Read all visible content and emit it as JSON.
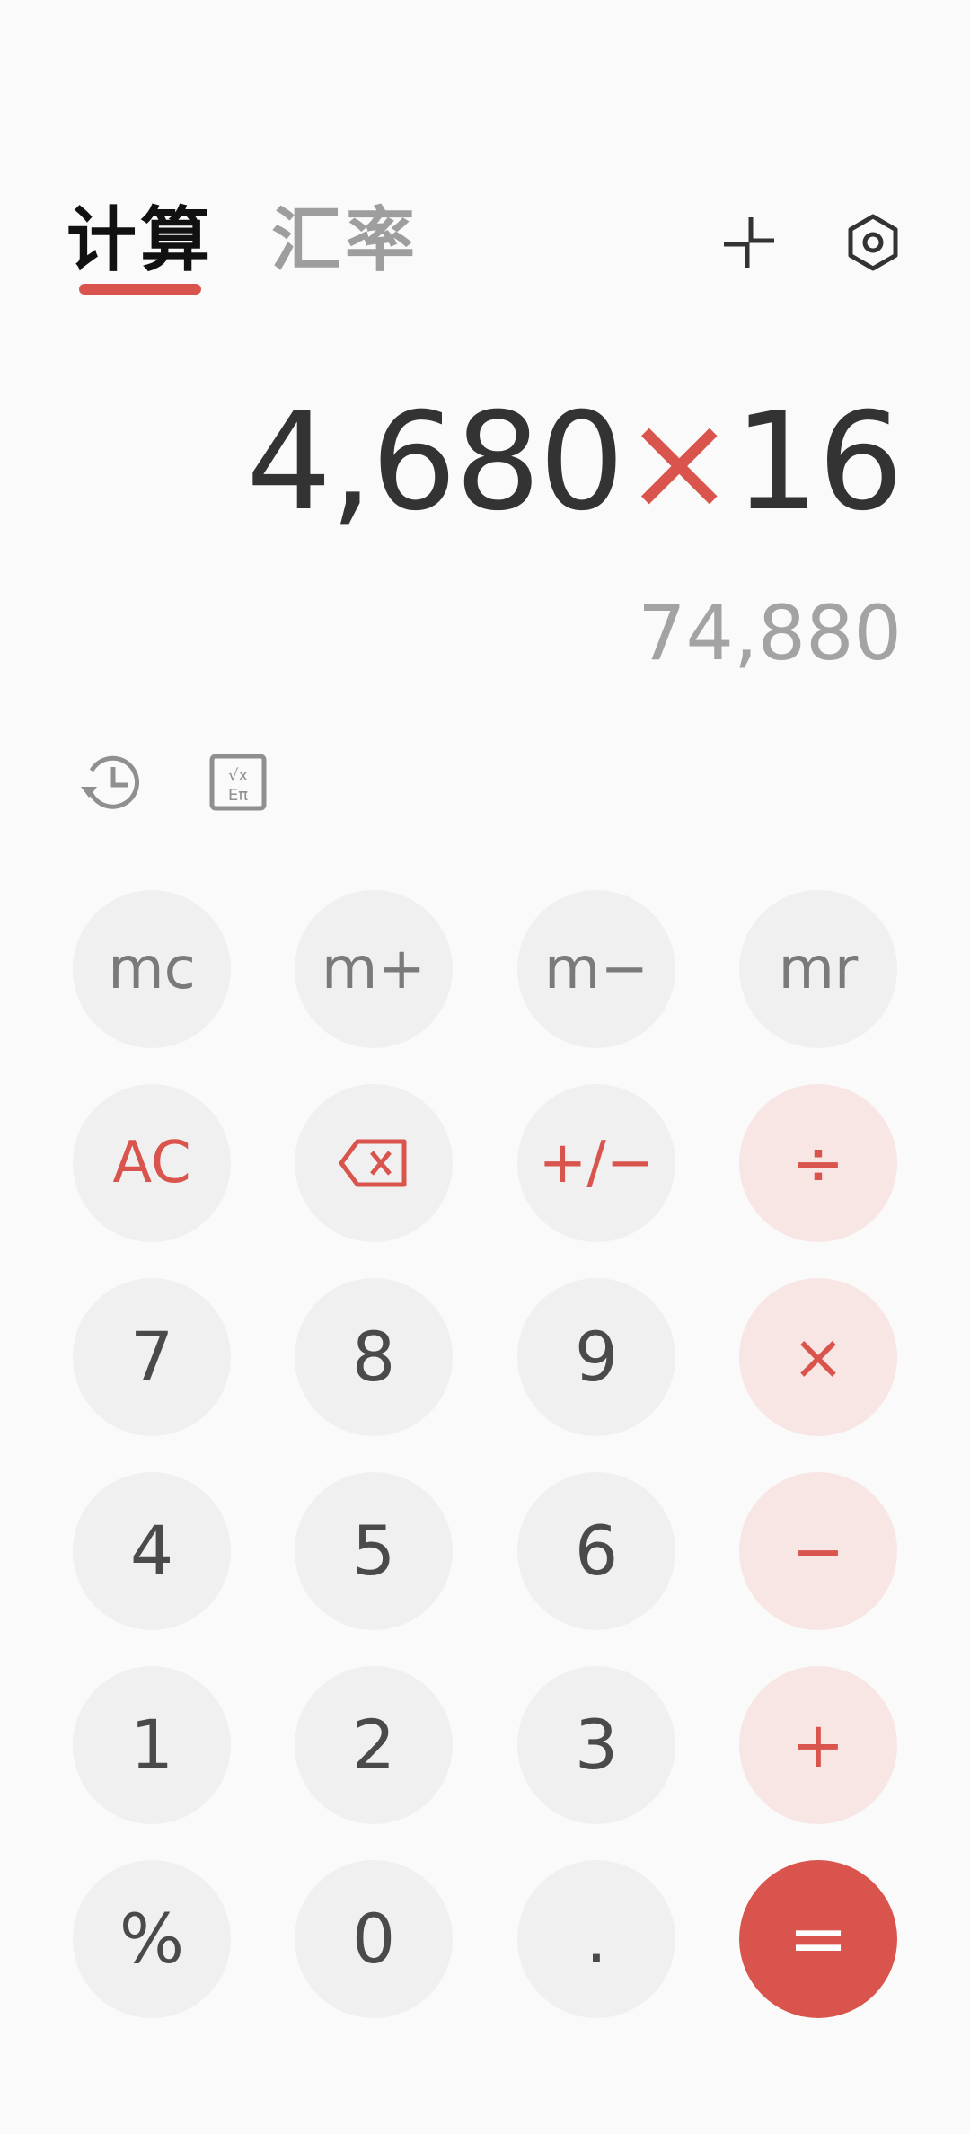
{
  "tabs": {
    "active": "计算",
    "inactive": "汇率"
  },
  "top_icons": [
    "minimize-icon",
    "settings-icon"
  ],
  "display": {
    "operand1": "4,680",
    "operator": "×",
    "operand2": "16",
    "result": "74,880"
  },
  "tool_icons": [
    "history-icon",
    "scientific-icon"
  ],
  "keys": {
    "mc": "mc",
    "mplus": "m+",
    "mminus": "m−",
    "mr": "mr",
    "ac": "AC",
    "backspace": "backspace-icon",
    "sign": "+/−",
    "divide": "÷",
    "seven": "7",
    "eight": "8",
    "nine": "9",
    "multiply": "×",
    "four": "4",
    "five": "5",
    "six": "6",
    "minus": "−",
    "one": "1",
    "two": "2",
    "three": "3",
    "plus": "+",
    "percent": "%",
    "zero": "0",
    "dot": ".",
    "equals": "="
  },
  "colors": {
    "accent": "#d9544c",
    "operator_key_bg": "#f8e6e5",
    "key_bg": "#f0f0f0",
    "background": "#fafafa"
  }
}
